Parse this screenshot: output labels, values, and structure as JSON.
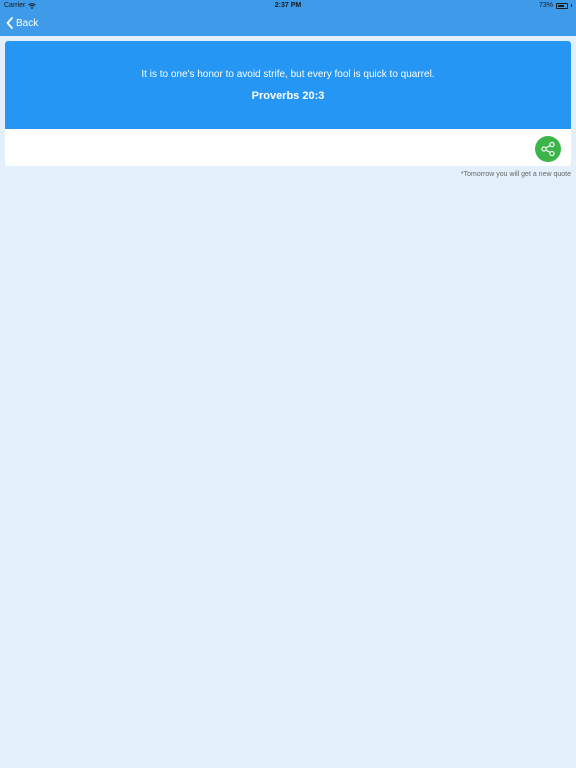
{
  "status_bar": {
    "carrier": "Carrier",
    "time": "2:37 PM",
    "battery": "73%",
    "battery_level": 0.73
  },
  "nav": {
    "back_label": "Back",
    "back_icon": "chevron-left-icon"
  },
  "quote": {
    "text": "It is to one's honor to avoid strife, but every fool is quick to quarrel.",
    "reference": "Proverbs 20:3"
  },
  "actions": {
    "share_icon": "share-icon"
  },
  "footnote": "*Tomorrow you will get a new quote",
  "colors": {
    "header": "#3d9be9",
    "card_accent": "#2596f3",
    "share_button": "#3bb54a",
    "background": "#e3f0fc"
  }
}
